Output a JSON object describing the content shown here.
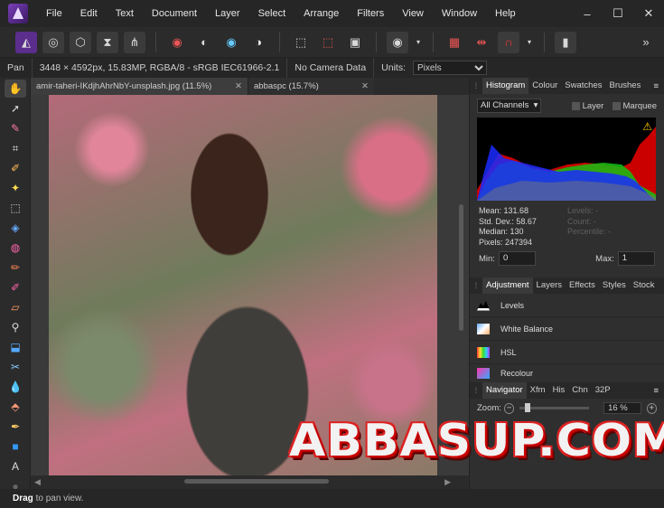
{
  "menubar": {
    "items": [
      "File",
      "Edit",
      "Text",
      "Document",
      "Layer",
      "Select",
      "Arrange",
      "Filters",
      "View",
      "Window",
      "Help"
    ],
    "min": "–",
    "max": "☐",
    "close": "✕"
  },
  "context": {
    "tool": "Pan",
    "doc_info": "3448 × 4592px, 15.83MP, RGBA/8 - sRGB IEC61966-2.1",
    "camera": "No Camera Data",
    "units_label": "Units:",
    "units_value": "Pixels"
  },
  "tabs": [
    {
      "label": "amir-taheri-IKdjhAhrNbY-unsplash.jpg (11.5%)",
      "close": "✕"
    },
    {
      "label": "abbaspc (15.7%)",
      "close": "✕"
    }
  ],
  "histogram": {
    "tabs": [
      "Histogram",
      "Colour",
      "Swatches",
      "Brushes"
    ],
    "channel": "All Channels",
    "layer_label": "Layer",
    "marquee_label": "Marquee",
    "stats": {
      "mean": "Mean: 131.68",
      "std": "Std. Dev.: 58.67",
      "median": "Median: 130",
      "pixels": "Pixels: 247394"
    },
    "stats_dim": {
      "levels": "Levels: -",
      "count": "Count: -",
      "percentile": "Percentile: -"
    },
    "min_label": "Min:",
    "min_value": "0",
    "max_label": "Max:",
    "max_value": "1"
  },
  "adjustment": {
    "tabs": [
      "Adjustment",
      "Layers",
      "Effects",
      "Styles",
      "Stock"
    ],
    "items": [
      "Levels",
      "White Balance",
      "HSL",
      "Recolour"
    ]
  },
  "navigator": {
    "tabs": [
      "Navigator",
      "Xfm",
      "His",
      "Chn",
      "32P"
    ],
    "zoom_label": "Zoom:",
    "zoom_value": "16 %"
  },
  "status": {
    "bold": "Drag",
    "rest": " to pan view."
  },
  "watermark": "ABBASUP.COM"
}
